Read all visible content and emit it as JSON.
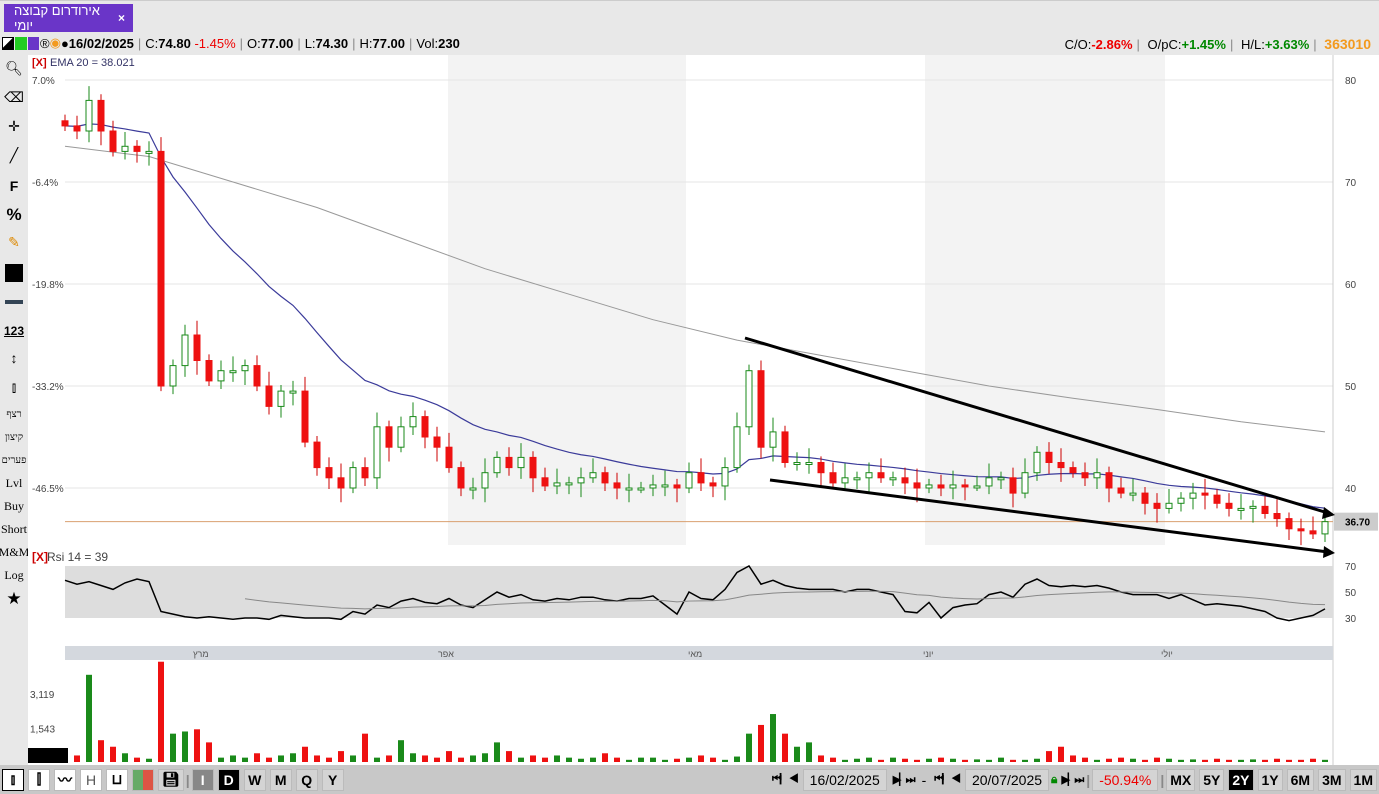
{
  "tab": {
    "title": "אירודרום קבוצה יומי",
    "close": "×"
  },
  "info": {
    "date": "16/02/2025",
    "c_label": "C:",
    "c": "74.80",
    "c_chg": "-1.45%",
    "o_label": "O:",
    "o": "77.00",
    "l_label": "L:",
    "l": "74.30",
    "h_label": "H:",
    "h": "77.00",
    "vol_label": "Vol:",
    "vol": "230",
    "co_label": "C/O:",
    "co": "-2.86%",
    "opc_label": "O/pC:",
    "opc": "+1.45%",
    "hl_label": "H/L:",
    "hl": "+3.63%",
    "code": "363010"
  },
  "left_toolbar": [
    "רצף",
    "קיצון",
    "פערים",
    "Lvl",
    "Buy",
    "Short",
    "M&M",
    "Log"
  ],
  "colors": {
    "up": "#1a8a1a",
    "down": "#ee1111",
    "ema20": "#3b3b9a",
    "ema_long": "#999999",
    "tab": "#6a35c8"
  },
  "chart_data": {
    "type": "candlestick",
    "indicator_label": "EMA 20 = 38.021",
    "price_axis": [
      "80",
      "70",
      "60",
      "50",
      "40"
    ],
    "pct_axis": [
      "7.0%",
      "-6.4%",
      "-19.8%",
      "-33.2%",
      "-46.5%"
    ],
    "last_price": "36.70",
    "ylim": [
      31,
      83
    ],
    "first_open": 76,
    "closes": [
      75.5,
      75,
      78,
      75,
      73,
      73.5,
      73,
      73,
      50,
      52,
      55,
      52.5,
      50.5,
      51.5,
      51.5,
      52,
      50,
      48,
      49.5,
      49.5,
      44.5,
      42,
      41,
      40,
      42,
      41,
      46,
      44,
      46,
      47,
      45,
      44,
      42,
      40,
      40,
      41.5,
      43,
      42,
      43,
      41,
      40.2,
      40.5,
      40.5,
      41,
      41.5,
      40.5,
      40,
      40,
      40,
      40.3,
      40.3,
      40,
      41.5,
      40.5,
      40.2,
      42,
      46,
      51.5,
      44,
      45.5,
      42.5,
      42.5,
      42.5,
      41.5,
      40.5,
      41,
      41,
      41.5,
      41,
      41,
      40.5,
      40,
      40.3,
      40,
      40.3,
      40.2,
      40.2,
      41,
      41,
      39.5,
      41.5,
      43.5,
      42.5,
      42,
      41.5,
      41,
      41.5,
      40,
      39.5,
      39.5,
      38.5,
      38,
      38.5,
      39,
      39.5,
      39.3,
      38.5,
      38,
      38,
      38.2,
      37.5,
      37,
      36,
      35.8,
      35.5,
      36.7
    ],
    "ema_long": [
      73.5,
      72.5,
      70,
      67.5,
      64.5,
      61.5,
      59,
      56.5,
      54.5,
      53,
      51.5,
      50,
      48.8,
      47.7,
      46.5,
      45.5
    ],
    "months": [
      "מרץ",
      "אפר",
      "מאי",
      "יוני",
      "יולי"
    ],
    "rsi_label": "Rsi 14 = 39",
    "rsi_axis": [
      "70",
      "50",
      "30"
    ],
    "rsi": [
      59,
      56,
      58,
      55,
      52,
      57,
      60,
      58,
      35,
      33,
      31,
      30,
      31,
      30,
      29,
      30,
      30,
      29,
      32,
      31,
      30,
      30,
      30,
      29,
      35,
      33,
      40,
      38,
      43,
      45,
      42,
      41,
      45,
      40,
      38,
      44,
      50,
      46,
      48,
      44,
      43,
      45,
      44,
      46,
      46,
      44,
      43,
      45,
      45,
      47,
      40,
      33,
      50,
      45,
      44,
      52,
      65,
      70,
      56,
      59,
      55,
      53,
      52,
      52,
      52,
      50,
      52,
      52,
      50,
      48,
      35,
      34,
      42,
      30,
      38,
      40,
      41,
      48,
      50,
      46,
      56,
      60,
      55,
      54,
      55,
      54,
      55,
      53,
      50,
      48,
      48,
      48,
      45,
      48,
      44,
      40,
      41,
      40,
      39,
      37,
      35,
      30,
      28,
      30,
      32,
      37
    ],
    "rsi_ma_start_index": 15,
    "volume_axis": [
      "3,119",
      "1,543"
    ],
    "volume": [
      200,
      300,
      4000,
      1000,
      700,
      400,
      200,
      150,
      4600,
      1300,
      1400,
      1500,
      900,
      200,
      300,
      200,
      400,
      200,
      300,
      400,
      700,
      300,
      200,
      500,
      300,
      1300,
      200,
      300,
      1000,
      400,
      300,
      200,
      500,
      200,
      300,
      400,
      900,
      500,
      200,
      300,
      200,
      300,
      200,
      150,
      200,
      400,
      200,
      100,
      200,
      200,
      100,
      150,
      200,
      300,
      200,
      100,
      250,
      1300,
      1700,
      2200,
      1300,
      700,
      900,
      300,
      200,
      100,
      150,
      200,
      100,
      200,
      150,
      100,
      150,
      200,
      150,
      100,
      120,
      100,
      200,
      100,
      100,
      150,
      500,
      700,
      300,
      200,
      100,
      150,
      200,
      150,
      100,
      200,
      150,
      100,
      120,
      100,
      150,
      100,
      100,
      120,
      100,
      150,
      100,
      100,
      150,
      100
    ]
  },
  "bottom": {
    "intervals": [
      "I",
      "D",
      "W",
      "M",
      "Q",
      "Y"
    ],
    "from": "16/02/2025",
    "dash": "-",
    "to": "20/07/2025",
    "change": "-50.94%",
    "ranges": [
      "MX",
      "5Y",
      "2Y",
      "1Y",
      "6M",
      "3M",
      "1M"
    ]
  }
}
